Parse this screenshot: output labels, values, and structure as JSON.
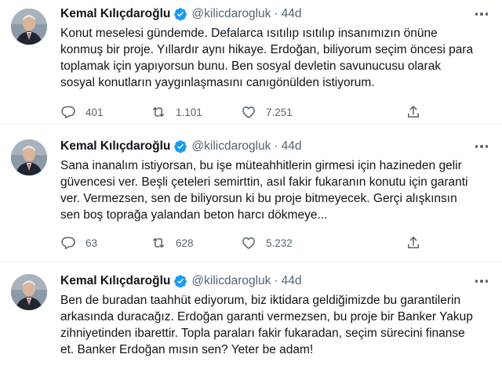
{
  "tweets": [
    {
      "name": "Kemal Kılıçdaroğlu",
      "handle": "@kilicdarogluk",
      "separator": "·",
      "time": "44d",
      "text": "Konut meselesi gündemde. Defalarca ısıtılıp ısıtılıp insanımızın önüne\nkonmuş bir proje. Yıllardır aynı hikaye. Erdoğan, biliyorum seçim öncesi para\ntoplamak için yapıyorsun bunu. Ben sosyal devletin savunucusu olarak\nsosyal konutların yaygınlaşmasını canıgönülden istiyorum.",
      "replies": "401",
      "retweets": "1.101",
      "likes": "7.251"
    },
    {
      "name": "Kemal Kılıçdaroğlu",
      "handle": "@kilicdarogluk",
      "separator": "·",
      "time": "44d",
      "text": "Sana inanalım istiyorsan, bu işe müteahhitlerin girmesi için hazineden gelir\ngüvencesi ver. Beşli çeteleri semirttin, asıl fakir fukaranın konutu için garanti\nver. Vermezsen, sen de biliyorsun ki bu proje bitmeyecek. Gerçi alışkınsın\nsen boş toprağa yalandan beton harcı dökmeye...",
      "replies": "63",
      "retweets": "628",
      "likes": "5.232"
    },
    {
      "name": "Kemal Kılıçdaroğlu",
      "handle": "@kilicdarogluk",
      "separator": "·",
      "time": "44d",
      "text": "Ben de buradan taahhüt ediyorum, biz iktidara geldiğimizde bu garantilerin\narkasında duracağız. Erdoğan garanti vermezsen, bu proje bir Banker Yakup\nzihniyetinden ibarettir. Topla paraları fakir fukaradan, seçim sürecini finanse\net. Banker Erdoğan mısın sen? Yeter be adam!"
    }
  ],
  "colors": {
    "text": "#0f1419",
    "secondary": "#536471",
    "verified": "#1d9bf0",
    "divider": "#eff3f4"
  },
  "icons": [
    "verified-badge-icon",
    "more-icon",
    "reply-icon",
    "retweet-icon",
    "like-icon",
    "share-icon"
  ]
}
